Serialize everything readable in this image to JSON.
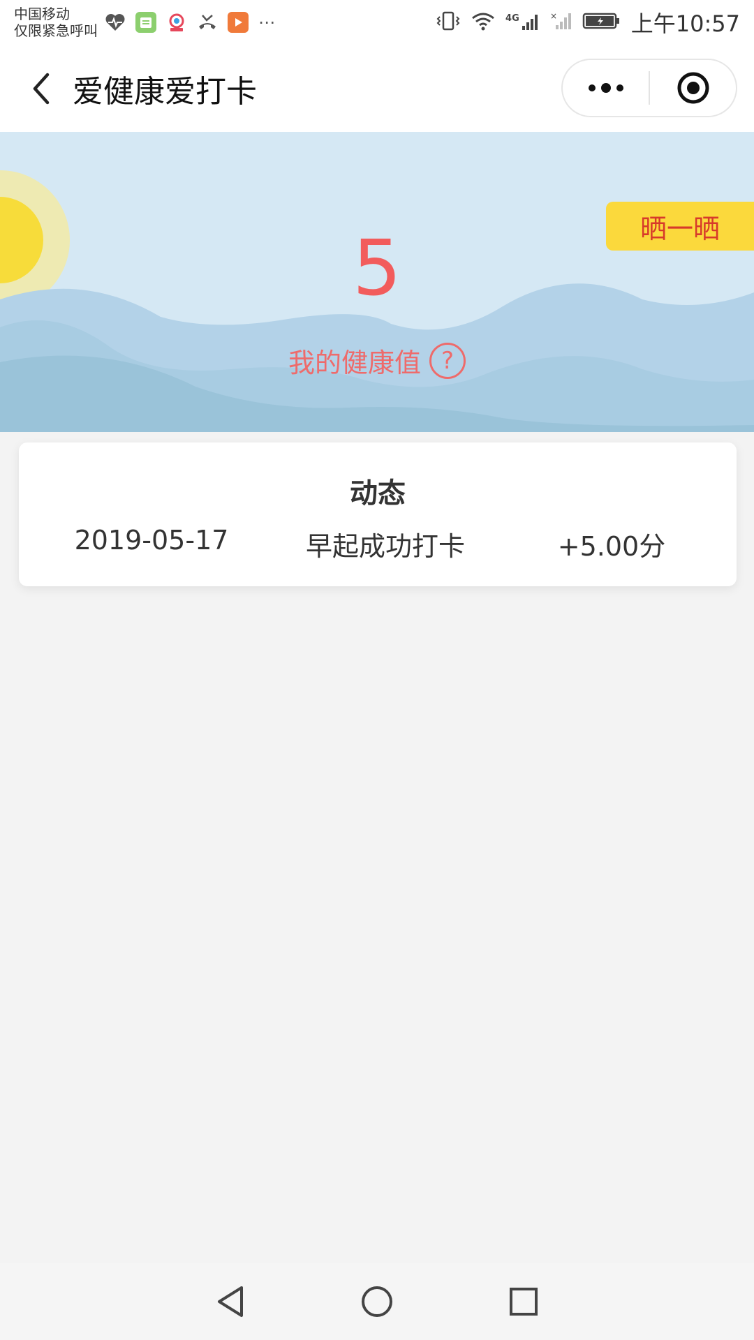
{
  "status_bar": {
    "carrier_line1": "中国移动",
    "carrier_line2": "仅限紧急呼叫",
    "network": "4G",
    "time": "上午10:57",
    "icons": [
      "health-icon",
      "calendar-icon",
      "camera-icon",
      "missed-call-icon",
      "video-icon",
      "more-dots-icon",
      "vibrate-icon",
      "wifi-icon",
      "signal-icon",
      "no-signal-icon",
      "battery-icon"
    ]
  },
  "header": {
    "title": "爱健康爱打卡",
    "back_icon": "chevron-left-icon",
    "menu_icon": "more-dots-icon",
    "close_icon": "target-icon"
  },
  "hero": {
    "share_label": "晒一晒",
    "score": "5",
    "score_label": "我的健康值",
    "help_icon": "question-circle-icon",
    "help_glyph": "?"
  },
  "activity": {
    "title": "动态",
    "rows": [
      {
        "date": "2019-05-17",
        "event": "早起成功打卡",
        "points": "+5.00分"
      }
    ]
  },
  "nav": {
    "icons": [
      "back-triangle-icon",
      "home-circle-icon",
      "recent-square-icon"
    ]
  },
  "colors": {
    "score": "#f25c5c",
    "share_bg": "#fbd93c",
    "share_text": "#d73a2a",
    "sky": "#d5e8f4"
  }
}
